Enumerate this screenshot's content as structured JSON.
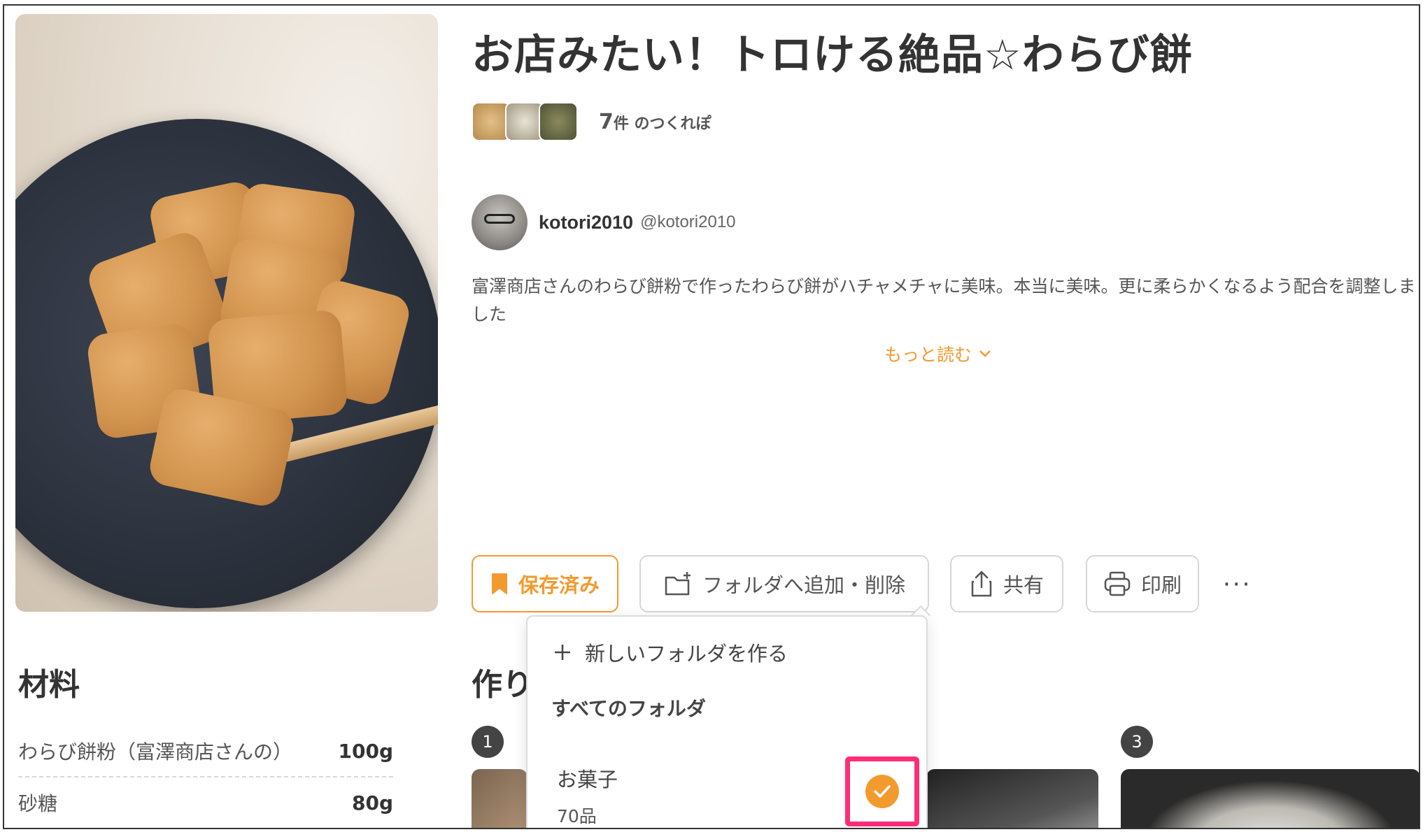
{
  "recipe": {
    "title": "お店みたい！トロける絶品☆わらび餅",
    "tsukurepo_count": "7",
    "tsukurepo_unit": "件 のつくれぽ",
    "description": "富澤商店さんのわらび餅粉で作ったわらび餅がハチャメチャに美味。本当に美味。更に柔らかくなるよう配合を調整しました",
    "read_more": "もっと読む"
  },
  "author": {
    "name": "kotori2010",
    "handle": "@kotori2010"
  },
  "actions": {
    "saved": "保存済み",
    "folder": "フォルダへ追加・削除",
    "share": "共有",
    "print": "印刷",
    "more": "···"
  },
  "sections": {
    "ingredients": "材料",
    "steps": "作り"
  },
  "ingredients": [
    {
      "name": "わらび餅粉（富澤商店さんの）",
      "amount": "100g"
    },
    {
      "name": "砂糖",
      "amount": "80g"
    }
  ],
  "steps": [
    "1",
    "3"
  ],
  "folder_menu": {
    "new_folder": "新しいフォルダを作る",
    "all_folders": "すべてのフォルダ",
    "folders": [
      {
        "name": "お菓子",
        "count": "70品",
        "checked": true
      }
    ]
  },
  "colors": {
    "accent": "#f39a2e",
    "highlight": "#ff2d78"
  }
}
